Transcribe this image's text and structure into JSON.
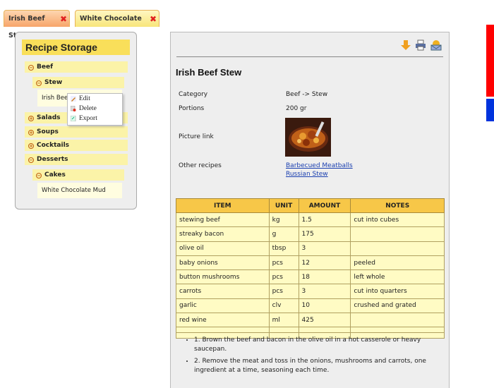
{
  "tabs": [
    {
      "label": "Irish Beef Stew",
      "active": true
    },
    {
      "label": "White Chocolate Mud",
      "active": false
    }
  ],
  "sidebar": {
    "title": "Recipe Storage",
    "categories": {
      "beef": "Beef",
      "stew": "Stew",
      "irish_beef_leaf": "Irish Beef",
      "salads": "Salads",
      "soups": "Soups",
      "cocktails": "Cocktails",
      "desserts": "Desserts",
      "cakes": "Cakes",
      "white_choc": "White Chocolate Mud"
    },
    "context_menu": {
      "edit": "Edit",
      "delete": "Delete",
      "export": "Export"
    }
  },
  "recipe": {
    "title": "Irish Beef Stew",
    "category_label": "Category",
    "category_value": "Beef -> Stew",
    "portions_label": "Portions",
    "portions_value": "200 gr",
    "picture_label": "Picture link",
    "other_label": "Other recipes",
    "other_links": [
      "Barbecued Meatballs",
      "Russian Stew"
    ],
    "table_headers": [
      "ITEM",
      "UNIT",
      "AMOUNT",
      "NOTES"
    ],
    "ingredients": [
      [
        "stewing beef",
        "kg",
        "1.5",
        "cut into cubes"
      ],
      [
        "streaky bacon",
        "g",
        "175",
        ""
      ],
      [
        "olive oil",
        "tbsp",
        "3",
        ""
      ],
      [
        "baby onions",
        "pcs",
        "12",
        "peeled"
      ],
      [
        "button mushrooms",
        "pcs",
        "18",
        "left whole"
      ],
      [
        "carrots",
        "pcs",
        "3",
        "cut into quarters"
      ],
      [
        "garlic",
        "clv",
        "10",
        "crushed and grated"
      ],
      [
        "red wine",
        "ml",
        "425",
        ""
      ]
    ],
    "steps": [
      "1. Brown the beef and bacon in the olive oil in a hot casserole or heavy saucepan.",
      "2. Remove the meat and toss in the onions, mushrooms and carrots, one ingredient at a time, seasoning each time."
    ]
  },
  "colors": {
    "tab_active": "#f7a56a",
    "tab_inactive": "#f8e57a",
    "header_yellow": "#f9df5a",
    "table_header": "#f7c748",
    "link": "#1a3fb0"
  },
  "icons": [
    "close-icon",
    "collapse-icon",
    "expand-icon",
    "download-icon",
    "print-icon",
    "email-icon"
  ]
}
